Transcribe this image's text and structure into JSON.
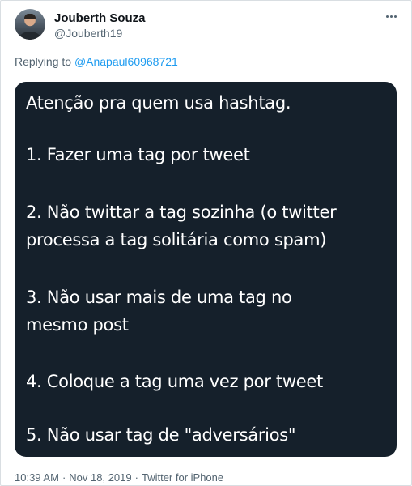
{
  "author": {
    "name": "Jouberth Souza",
    "handle": "@Jouberth19"
  },
  "more_icon": "more-horizontal-icon",
  "reply": {
    "prefix": "Replying to",
    "to": "@Anapaul60968721"
  },
  "image_text": {
    "line1": "Atenção pra quem usa hashtag.",
    "line2": "1. Fazer uma tag por tweet",
    "line3": "2. Não twittar a tag sozinha (o twitter",
    "line4": "processa a tag solitária como spam)",
    "line5": "3. Não usar mais de uma tag no",
    "line6": "mesmo post",
    "line7": "4. Coloque a tag uma vez por tweet",
    "line8": "5. Não usar tag de \"adversários\""
  },
  "meta": {
    "time": "10:39 AM",
    "date": "Nov 18, 2019",
    "source": "Twitter for iPhone",
    "separator": "·"
  },
  "colors": {
    "image_background": "#15202b",
    "link": "#1d9bf0",
    "secondary_text": "#536471"
  }
}
